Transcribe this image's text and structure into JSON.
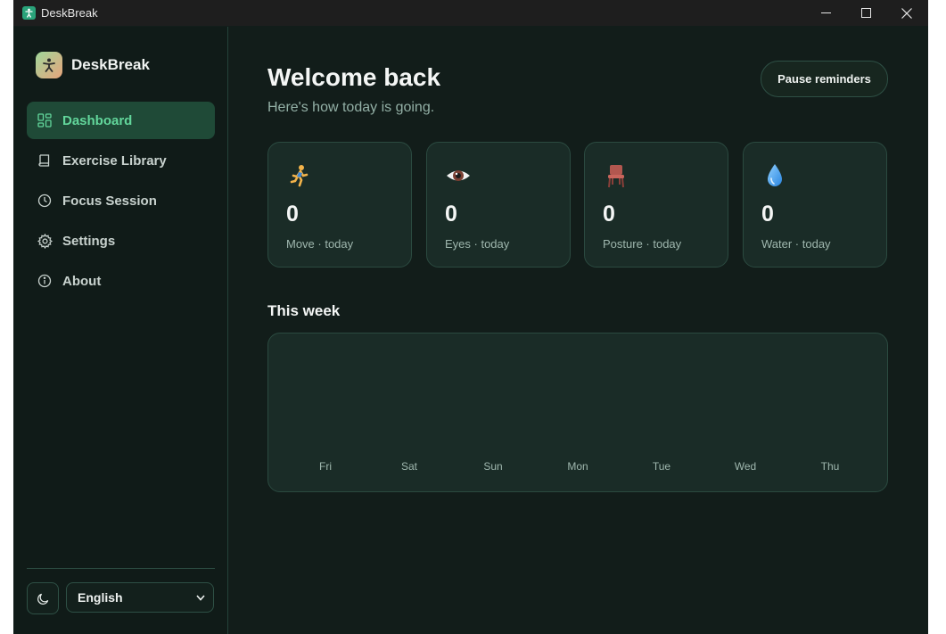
{
  "window": {
    "title": "DeskBreak",
    "controls": [
      "minimize-icon",
      "maximize-icon",
      "close-icon"
    ]
  },
  "sidebar": {
    "brand": "DeskBreak",
    "items": [
      {
        "label": "Dashboard",
        "icon": "dashboard-grid-icon",
        "active": true
      },
      {
        "label": "Exercise Library",
        "icon": "book-icon",
        "active": false
      },
      {
        "label": "Focus Session",
        "icon": "clock-icon",
        "active": false
      },
      {
        "label": "Settings",
        "icon": "gear-icon",
        "active": false
      },
      {
        "label": "About",
        "icon": "info-icon",
        "active": false
      }
    ],
    "theme_toggle_icon": "moon-icon",
    "language": "English"
  },
  "main": {
    "title": "Welcome back",
    "subtitle": "Here's how today is going.",
    "pause_label": "Pause reminders",
    "stats": [
      {
        "icon": "running-person-icon",
        "value": "0",
        "label": "Move · today"
      },
      {
        "icon": "eye-icon",
        "value": "0",
        "label": "Eyes · today"
      },
      {
        "icon": "chair-icon",
        "value": "0",
        "label": "Posture · today"
      },
      {
        "icon": "water-drop-icon",
        "value": "0",
        "label": "Water · today"
      }
    ],
    "week_title": "This week",
    "week_days": [
      "Fri",
      "Sat",
      "Sun",
      "Mon",
      "Tue",
      "Wed",
      "Thu"
    ]
  },
  "colors": {
    "background": "#121d1a",
    "sidebar": "#101b18",
    "card": "#1a2c27",
    "accent": "#62d69b",
    "active_nav": "#1f4a37"
  }
}
